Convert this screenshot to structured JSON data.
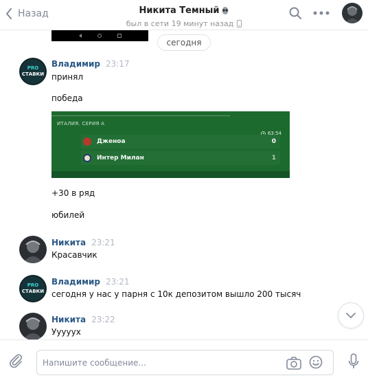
{
  "header": {
    "back_label": "Назад",
    "contact_name": "Никита Темный",
    "status": "был в сети 19 минут назад"
  },
  "chat": {
    "date_separator": "сегодня",
    "messages": [
      {
        "sender": "Владимир",
        "time": "23:17",
        "avatar": "pro-stavki-avatar",
        "avatar_text_line1": "PRO",
        "avatar_text_line2": "СТАВКИ",
        "lines": [
          "принял",
          "победа"
        ],
        "attachment": {
          "league": "ИТАЛИЯ. СЕРИЯ А",
          "time": "63:54",
          "teams": [
            {
              "name": "Дженоа",
              "score": "0"
            },
            {
              "name": "Интер Милан",
              "score": "1"
            }
          ]
        },
        "after_lines": [
          "+30 в ряд",
          "юбилей"
        ]
      },
      {
        "sender": "Никита",
        "time": "23:21",
        "avatar": "nikita-avatar",
        "lines": [
          "Красавчик"
        ]
      },
      {
        "sender": "Владимир",
        "time": "23:21",
        "avatar": "pro-stavki-avatar",
        "avatar_text_line1": "PRO",
        "avatar_text_line2": "СТАВКИ",
        "lines": [
          "сегодня у нас у парня с 10к депозитом вышло 200 тысяч"
        ]
      },
      {
        "sender": "Никита",
        "time": "23:22",
        "avatar": "nikita-avatar",
        "lines": [
          "Ууууух"
        ]
      }
    ]
  },
  "composer": {
    "placeholder": "Напишите сообщение..."
  },
  "colors": {
    "name_link": "#2a5885",
    "time_gray": "#b2b9c2",
    "match_green": "#1d6a2e"
  }
}
